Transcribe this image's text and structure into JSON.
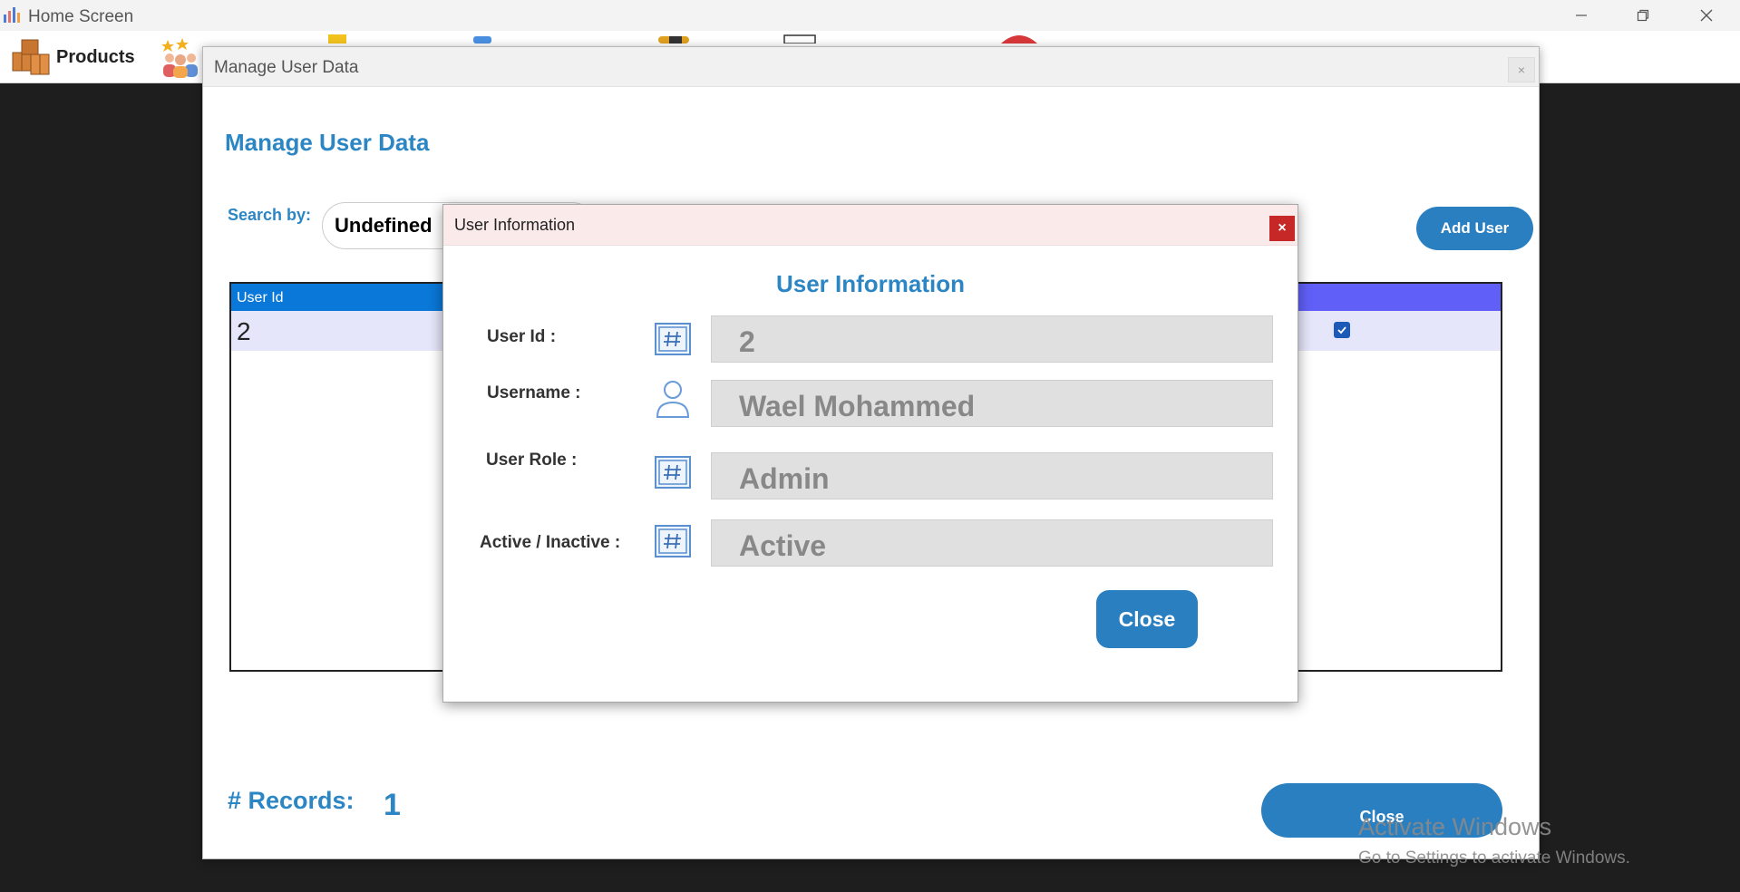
{
  "main_window": {
    "title": "Home Screen",
    "controls": {
      "minimize": "minimize-icon",
      "maximize": "restore-icon",
      "close": "close-icon"
    }
  },
  "toolbar": {
    "items": [
      {
        "label": "Products",
        "icon": "boxes-icon"
      },
      {
        "label": "",
        "icon": "users-group-icon"
      }
    ]
  },
  "manage_user_window": {
    "title": "Manage User Data",
    "heading": "Manage User Data",
    "search_label": "Search by:",
    "search_selected": "Undefined",
    "add_user_label": "Add User",
    "grid": {
      "columns": [
        "User Id"
      ],
      "rows": [
        {
          "user_id": "2",
          "active": true
        }
      ]
    },
    "records_label": "# Records:",
    "records_count": "1",
    "close_label": "Close"
  },
  "user_info_dialog": {
    "title": "User Information",
    "heading": "User Information",
    "fields": [
      {
        "label": "User Id :",
        "value": "2",
        "icon": "hash-icon"
      },
      {
        "label": "Username :",
        "value": "Wael Mohammed",
        "icon": "user-icon"
      },
      {
        "label": "User Role :",
        "value": "Admin",
        "icon": "hash-icon"
      },
      {
        "label": "Active / Inactive :",
        "value": "Active",
        "icon": "hash-icon"
      }
    ],
    "close_label": "Close"
  },
  "watermark": {
    "line1": "Activate Windows",
    "line2": "Go to Settings to activate Windows."
  },
  "colors": {
    "accent": "#2a7fc0",
    "heading": "#2d86c4",
    "grid_header_left": "#0a78d8",
    "grid_header_right": "#6060f8",
    "dialog_close": "#c62828"
  }
}
